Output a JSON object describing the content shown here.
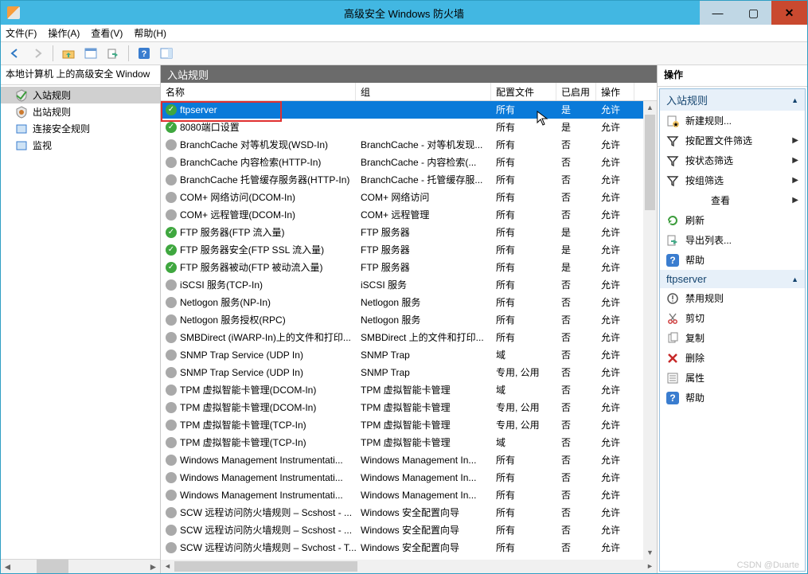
{
  "window": {
    "title": "高级安全 Windows 防火墙"
  },
  "menus": {
    "file": "文件(F)",
    "action": "操作(A)",
    "view": "查看(V)",
    "help": "帮助(H)"
  },
  "tree": {
    "root": "本地计算机 上的高级安全 Window",
    "items": [
      {
        "label": "入站规则",
        "iconColor": "#3c9c3c",
        "selected": true
      },
      {
        "label": "出站规则",
        "iconColor": "#cc7a2e",
        "selected": false
      },
      {
        "label": "连接安全规则",
        "iconColor": "#3a7dcf",
        "selected": false
      },
      {
        "label": "监视",
        "iconColor": "#3a7dcf",
        "selected": false
      }
    ]
  },
  "rules": {
    "header": "入站规则",
    "cols": {
      "name": "名称",
      "group": "组",
      "profile": "配置文件",
      "enabled": "已启用",
      "action": "操作"
    },
    "rows": [
      {
        "name": "ftpserver",
        "group": "",
        "profile": "所有",
        "enabled": "是",
        "action": "允许",
        "on": true,
        "selected": true
      },
      {
        "name": "8080端口设置",
        "group": "",
        "profile": "所有",
        "enabled": "是",
        "action": "允许",
        "on": true
      },
      {
        "name": "BranchCache 对等机发现(WSD-In)",
        "group": "BranchCache - 对等机发现...",
        "profile": "所有",
        "enabled": "否",
        "action": "允许",
        "on": false
      },
      {
        "name": "BranchCache 内容检索(HTTP-In)",
        "group": "BranchCache - 内容检索(...",
        "profile": "所有",
        "enabled": "否",
        "action": "允许",
        "on": false
      },
      {
        "name": "BranchCache 托管缓存服务器(HTTP-In)",
        "group": "BranchCache - 托管缓存服...",
        "profile": "所有",
        "enabled": "否",
        "action": "允许",
        "on": false
      },
      {
        "name": "COM+ 网络访问(DCOM-In)",
        "group": "COM+ 网络访问",
        "profile": "所有",
        "enabled": "否",
        "action": "允许",
        "on": false
      },
      {
        "name": "COM+ 远程管理(DCOM-In)",
        "group": "COM+ 远程管理",
        "profile": "所有",
        "enabled": "否",
        "action": "允许",
        "on": false
      },
      {
        "name": "FTP 服务器(FTP 流入量)",
        "group": "FTP 服务器",
        "profile": "所有",
        "enabled": "是",
        "action": "允许",
        "on": true
      },
      {
        "name": "FTP 服务器安全(FTP SSL 流入量)",
        "group": "FTP 服务器",
        "profile": "所有",
        "enabled": "是",
        "action": "允许",
        "on": true
      },
      {
        "name": "FTP 服务器被动(FTP 被动流入量)",
        "group": "FTP 服务器",
        "profile": "所有",
        "enabled": "是",
        "action": "允许",
        "on": true
      },
      {
        "name": "iSCSI 服务(TCP-In)",
        "group": "iSCSI 服务",
        "profile": "所有",
        "enabled": "否",
        "action": "允许",
        "on": false
      },
      {
        "name": "Netlogon 服务(NP-In)",
        "group": "Netlogon 服务",
        "profile": "所有",
        "enabled": "否",
        "action": "允许",
        "on": false
      },
      {
        "name": "Netlogon 服务授权(RPC)",
        "group": "Netlogon 服务",
        "profile": "所有",
        "enabled": "否",
        "action": "允许",
        "on": false
      },
      {
        "name": "SMBDirect (iWARP-In)上的文件和打印...",
        "group": "SMBDirect 上的文件和打印...",
        "profile": "所有",
        "enabled": "否",
        "action": "允许",
        "on": false
      },
      {
        "name": "SNMP Trap Service (UDP In)",
        "group": "SNMP Trap",
        "profile": "域",
        "enabled": "否",
        "action": "允许",
        "on": false
      },
      {
        "name": "SNMP Trap Service (UDP In)",
        "group": "SNMP Trap",
        "profile": "专用, 公用",
        "enabled": "否",
        "action": "允许",
        "on": false
      },
      {
        "name": "TPM 虚拟智能卡管理(DCOM-In)",
        "group": "TPM 虚拟智能卡管理",
        "profile": "域",
        "enabled": "否",
        "action": "允许",
        "on": false
      },
      {
        "name": "TPM 虚拟智能卡管理(DCOM-In)",
        "group": "TPM 虚拟智能卡管理",
        "profile": "专用, 公用",
        "enabled": "否",
        "action": "允许",
        "on": false
      },
      {
        "name": "TPM 虚拟智能卡管理(TCP-In)",
        "group": "TPM 虚拟智能卡管理",
        "profile": "专用, 公用",
        "enabled": "否",
        "action": "允许",
        "on": false
      },
      {
        "name": "TPM 虚拟智能卡管理(TCP-In)",
        "group": "TPM 虚拟智能卡管理",
        "profile": "域",
        "enabled": "否",
        "action": "允许",
        "on": false
      },
      {
        "name": "Windows Management Instrumentati...",
        "group": "Windows Management In...",
        "profile": "所有",
        "enabled": "否",
        "action": "允许",
        "on": false
      },
      {
        "name": "Windows Management Instrumentati...",
        "group": "Windows Management In...",
        "profile": "所有",
        "enabled": "否",
        "action": "允许",
        "on": false
      },
      {
        "name": "Windows Management Instrumentati...",
        "group": "Windows Management In...",
        "profile": "所有",
        "enabled": "否",
        "action": "允许",
        "on": false
      },
      {
        "name": "SCW 远程访问防火墙规则 – Scshost - ...",
        "group": "Windows 安全配置向导",
        "profile": "所有",
        "enabled": "否",
        "action": "允许",
        "on": false
      },
      {
        "name": "SCW 远程访问防火墙规则 – Scshost - ...",
        "group": "Windows 安全配置向导",
        "profile": "所有",
        "enabled": "否",
        "action": "允许",
        "on": false
      },
      {
        "name": "SCW 远程访问防火墙规则 – Svchost - T...",
        "group": "Windows 安全配置向导",
        "profile": "所有",
        "enabled": "否",
        "action": "允许",
        "on": false
      }
    ]
  },
  "actions": {
    "title": "操作",
    "section1": "入站规则",
    "items1": [
      {
        "icon": "new",
        "label": "新建规则..."
      },
      {
        "icon": "filter",
        "label": "按配置文件筛选",
        "sub": true
      },
      {
        "icon": "filter",
        "label": "按状态筛选",
        "sub": true
      },
      {
        "icon": "filter",
        "label": "按组筛选",
        "sub": true
      },
      {
        "icon": "view",
        "label": "查看",
        "sub": true
      },
      {
        "icon": "refresh",
        "label": "刷新"
      },
      {
        "icon": "export",
        "label": "导出列表..."
      },
      {
        "icon": "help",
        "label": "帮助"
      }
    ],
    "section2": "ftpserver",
    "items2": [
      {
        "icon": "disable",
        "label": "禁用规则"
      },
      {
        "icon": "cut",
        "label": "剪切"
      },
      {
        "icon": "copy",
        "label": "复制"
      },
      {
        "icon": "delete",
        "label": "删除"
      },
      {
        "icon": "props",
        "label": "属性"
      },
      {
        "icon": "help",
        "label": "帮助"
      }
    ]
  },
  "watermark": "CSDN @Duarte"
}
